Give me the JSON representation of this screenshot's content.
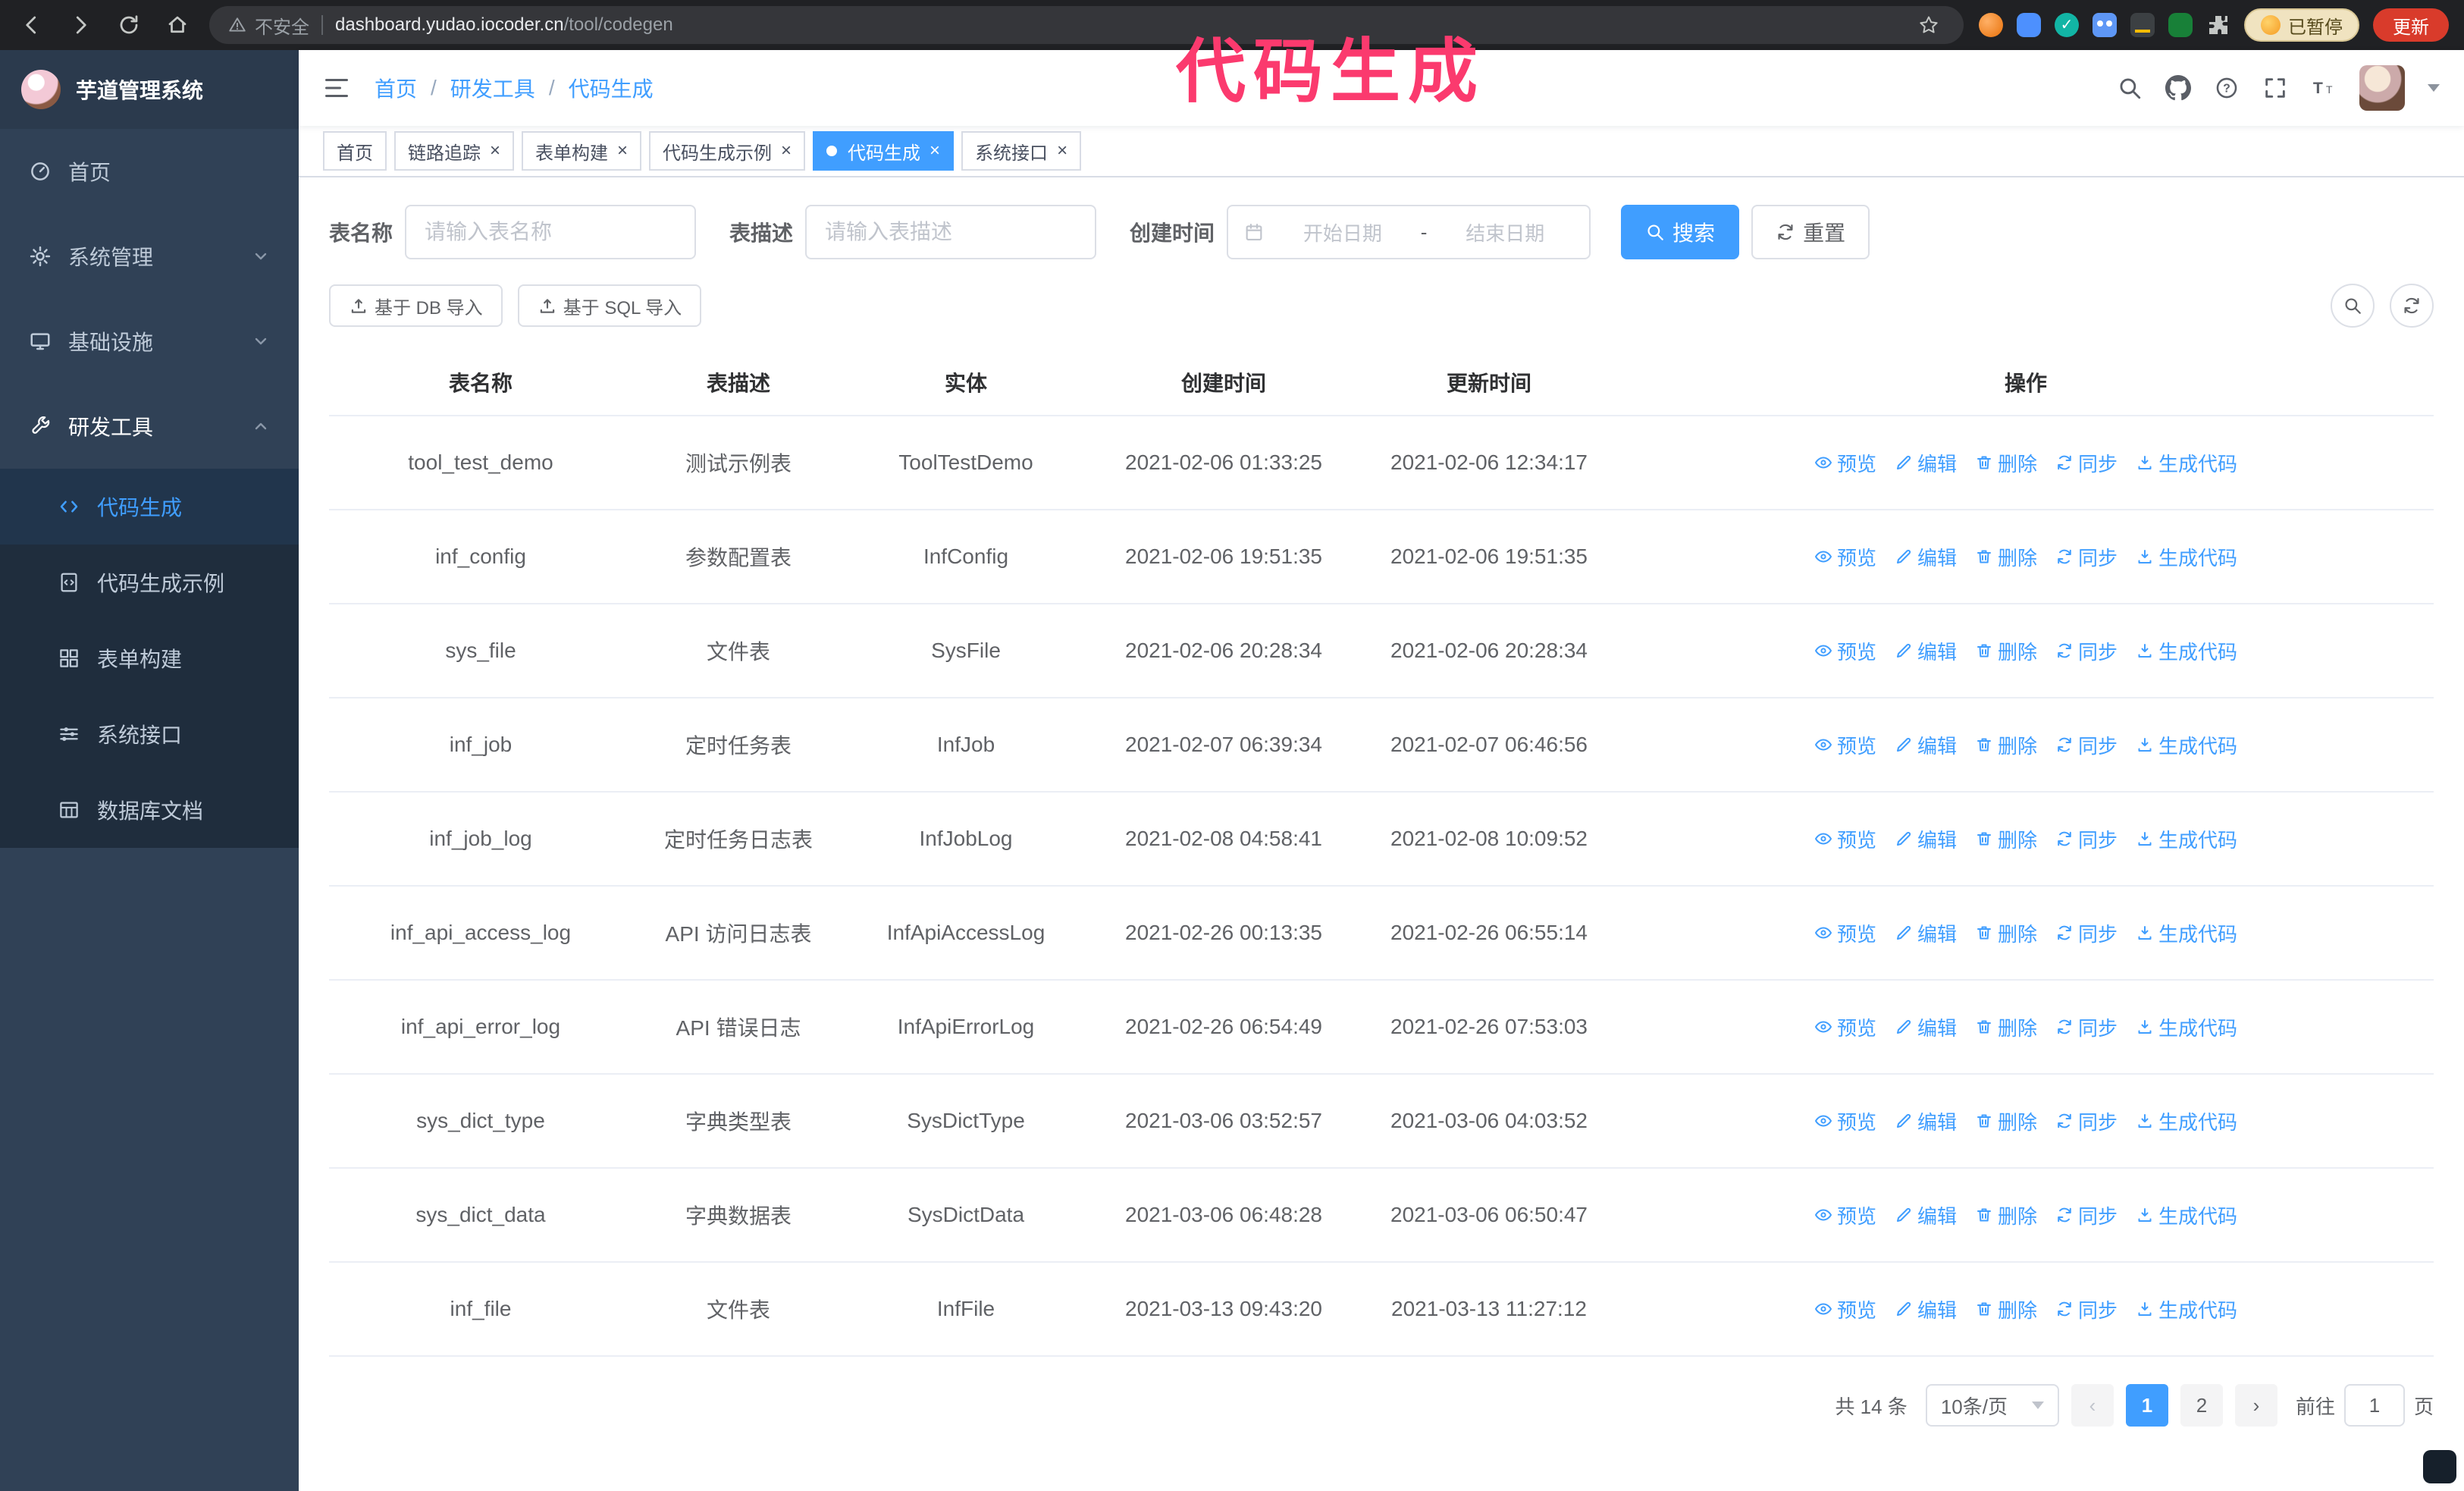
{
  "annotation": "代码生成",
  "browser": {
    "security_label": "不安全",
    "url_host": "dashboard.yudao.iocoder.cn",
    "url_path": "/tool/codegen",
    "paused_badge": "已暂停",
    "update_label": "更新"
  },
  "sidebar": {
    "logo_title": "芋道管理系统",
    "items": [
      {
        "label": "首页"
      },
      {
        "label": "系统管理"
      },
      {
        "label": "基础设施"
      },
      {
        "label": "研发工具"
      }
    ],
    "submenu": [
      {
        "label": "代码生成"
      },
      {
        "label": "代码生成示例"
      },
      {
        "label": "表单构建"
      },
      {
        "label": "系统接口"
      },
      {
        "label": "数据库文档"
      }
    ]
  },
  "breadcrumb": {
    "separator": "/",
    "items": [
      "首页",
      "研发工具",
      "代码生成"
    ]
  },
  "tabs": [
    {
      "label": "首页"
    },
    {
      "label": "链路追踪"
    },
    {
      "label": "表单构建"
    },
    {
      "label": "代码生成示例"
    },
    {
      "label": "代码生成"
    },
    {
      "label": "系统接口"
    }
  ],
  "filters": {
    "table_name_label": "表名称",
    "table_name_placeholder": "请输入表名称",
    "table_desc_label": "表描述",
    "table_desc_placeholder": "请输入表描述",
    "create_time_label": "创建时间",
    "date_start_placeholder": "开始日期",
    "date_separator": "-",
    "date_end_placeholder": "结束日期",
    "search_label": "搜索",
    "reset_label": "重置"
  },
  "toolbar": {
    "import_db": "基于 DB 导入",
    "import_sql": "基于 SQL 导入"
  },
  "table": {
    "columns": [
      "表名称",
      "表描述",
      "实体",
      "创建时间",
      "更新时间",
      "操作"
    ],
    "actions": [
      {
        "key": "preview",
        "label": "预览",
        "icon": "eye"
      },
      {
        "key": "edit",
        "label": "编辑",
        "icon": "edit"
      },
      {
        "key": "delete",
        "label": "删除",
        "icon": "trash"
      },
      {
        "key": "sync",
        "label": "同步",
        "icon": "sync"
      },
      {
        "key": "generate",
        "label": "生成代码",
        "icon": "download"
      }
    ],
    "rows": [
      {
        "name": "tool_test_demo",
        "desc": "测试示例表",
        "entity": "ToolTestDemo",
        "created": "2021-02-06 01:33:25",
        "updated": "2021-02-06 12:34:17"
      },
      {
        "name": "inf_config",
        "desc": "参数配置表",
        "entity": "InfConfig",
        "created": "2021-02-06 19:51:35",
        "updated": "2021-02-06 19:51:35"
      },
      {
        "name": "sys_file",
        "desc": "文件表",
        "entity": "SysFile",
        "created": "2021-02-06 20:28:34",
        "updated": "2021-02-06 20:28:34"
      },
      {
        "name": "inf_job",
        "desc": "定时任务表",
        "entity": "InfJob",
        "created": "2021-02-07 06:39:34",
        "updated": "2021-02-07 06:46:56"
      },
      {
        "name": "inf_job_log",
        "desc": "定时任务日志表",
        "entity": "InfJobLog",
        "created": "2021-02-08 04:58:41",
        "updated": "2021-02-08 10:09:52"
      },
      {
        "name": "inf_api_access_log",
        "desc": "API 访问日志表",
        "entity": "InfApiAccessLog",
        "created": "2021-02-26 00:13:35",
        "updated": "2021-02-26 06:55:14"
      },
      {
        "name": "inf_api_error_log",
        "desc": "API 错误日志",
        "entity": "InfApiErrorLog",
        "created": "2021-02-26 06:54:49",
        "updated": "2021-02-26 07:53:03"
      },
      {
        "name": "sys_dict_type",
        "desc": "字典类型表",
        "entity": "SysDictType",
        "created": "2021-03-06 03:52:57",
        "updated": "2021-03-06 04:03:52"
      },
      {
        "name": "sys_dict_data",
        "desc": "字典数据表",
        "entity": "SysDictData",
        "created": "2021-03-06 06:48:28",
        "updated": "2021-03-06 06:50:47"
      },
      {
        "name": "inf_file",
        "desc": "文件表",
        "entity": "InfFile",
        "created": "2021-03-13 09:43:20",
        "updated": "2021-03-13 11:27:12"
      }
    ]
  },
  "pagination": {
    "total": "共 14 条",
    "page_size": "10条/页",
    "prev": "‹",
    "next": "›",
    "pages": [
      "1",
      "2"
    ],
    "active_page": "1",
    "goto_prefix": "前往",
    "goto_value": "1",
    "goto_suffix": "页"
  },
  "ui": {
    "close": "×"
  },
  "colors": {
    "primary": "#409eff",
    "annotation": "#fb3a6e",
    "sidebar_bg": "#304156",
    "submenu_bg": "#1f2d3d"
  }
}
